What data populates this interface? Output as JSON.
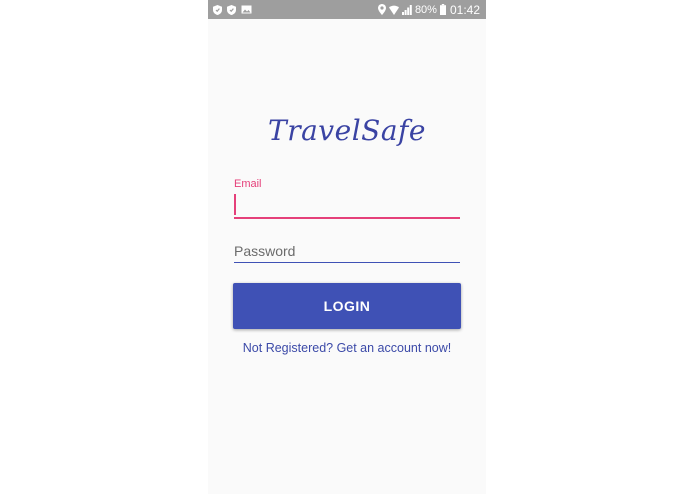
{
  "status_bar": {
    "left_icons": [
      "shield-icon",
      "shield-icon",
      "image-icon"
    ],
    "right_icons": [
      "location-icon",
      "wifi-icon",
      "signal-icon"
    ],
    "battery_text": "80%",
    "time": "01:42"
  },
  "app": {
    "title": "TravelSafe",
    "email_label": "Email",
    "email_value": "",
    "password_placeholder": "Password",
    "login_label": "LOGIN",
    "register_text": "Not Registered? Get an account now!"
  },
  "colors": {
    "primary": "#3f51b5",
    "accent": "#e5407a",
    "statusbar": "#9e9e9e",
    "background": "#fafafa"
  }
}
